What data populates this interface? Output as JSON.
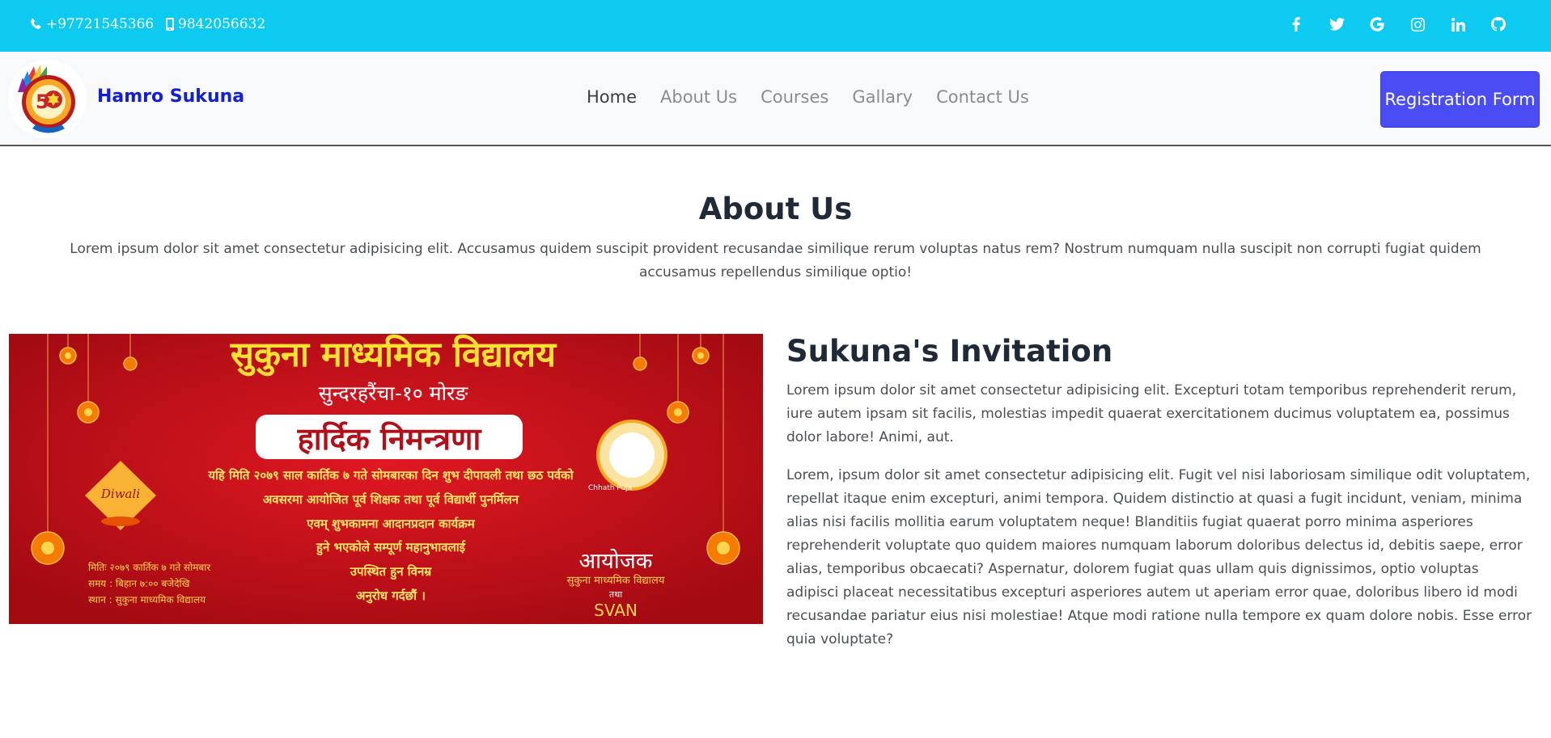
{
  "topbar": {
    "phone": "+97721545366",
    "mobile": "9842056632",
    "social_icons": [
      "facebook-icon",
      "twitter-icon",
      "google-icon",
      "instagram-icon",
      "linkedin-icon",
      "github-icon"
    ]
  },
  "navbar": {
    "brand": "Hamro Sukuna",
    "links": [
      "Home",
      "About Us",
      "Courses",
      "Gallary",
      "Contact Us"
    ],
    "active": "Home",
    "register_button": "Registration Form"
  },
  "about": {
    "title": "About Us",
    "text": "Lorem ipsum dolor sit amet consectetur adipisicing elit. Accusamus quidem suscipit provident recusandae similique rerum voluptas natus rem? Nostrum numquam nulla suscipit non corrupti fugiat quidem accusamus repellendus similique optio!"
  },
  "banner": {
    "school_name": "सुकुना माध्यमिक विद्यालय",
    "address": "सुन्दरहरैंचा-१० मोरङ",
    "heading": "हार्दिक निमन्त्रणा",
    "lines": [
      "यहि मिति २०७९ साल कार्तिक ७ गते सोमबारका दिन शुभ दीपावली तथा छठ पर्वको",
      "अवसरमा आयोजित पूर्व शिक्षक तथा पूर्व विद्यार्थी पुनर्मिलन",
      "एवम् शुभकामना आदानप्रदान कार्यक्रम",
      "हुने भएकोले सम्पूर्ण महानुभावलाई",
      "उपस्थित हुन विनम्र",
      "अनुरोध गर्दछौं ।"
    ],
    "details": [
      "मितिः २०७९ कार्तिक ७ गते सोमबार",
      "समय : बिहान ७:०० बजेदेखि",
      "स्थान : सुकुना माध्यमिक विद्यालय"
    ],
    "organizer_title": "आयोजक",
    "organizer_lines": [
      "सुकुना माध्यमिक विद्यालय",
      "तथा"
    ],
    "organizer_sub": "SVAN",
    "diwali_label": "Diwali",
    "chhath_label": "Chhath Puja"
  },
  "invitation": {
    "title": "Sukuna's Invitation",
    "para1": "Lorem ipsum dolor sit amet consectetur adipisicing elit. Excepturi totam temporibus reprehenderit rerum, iure autem ipsam sit facilis, molestias impedit quaerat exercitationem ducimus voluptatem ea, possimus dolor labore! Animi, aut.",
    "para2": "Lorem, ipsum dolor sit amet consectetur adipisicing elit. Fugit vel nisi laboriosam similique odit voluptatem, repellat itaque enim excepturi, animi tempora. Quidem distinctio at quasi a fugit incidunt, veniam, minima alias nisi facilis mollitia earum voluptatem neque! Blanditiis fugiat quaerat porro minima asperiores reprehenderit voluptate quo quidem maiores numquam laborum doloribus delectus id, debitis saepe, error alias, temporibus obcaecati? Aspernatur, dolorem fugiat quas ullam quis dignissimos, optio voluptas adipisci placeat necessitatibus excepturi asperiores autem ut aperiam error quae, doloribus libero id modi recusandae pariatur eius nisi molestiae! Atque modi ratione nulla tempore ex quam dolore nobis. Esse error quia voluptate?"
  },
  "colors": {
    "topbar": "#0dcaf0",
    "brand": "#1420cc",
    "button": "#4c4cf5",
    "banner_red": "#c4101a",
    "banner_yellow": "#ffe033"
  }
}
